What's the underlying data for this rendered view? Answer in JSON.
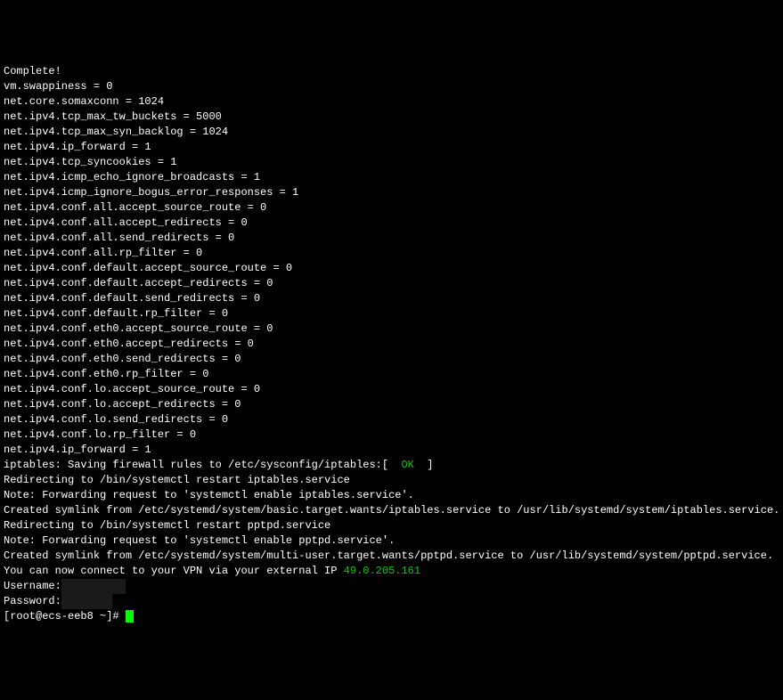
{
  "terminal": {
    "lines": [
      {
        "text": "Complete!"
      },
      {
        "text": "vm.swappiness = 0"
      },
      {
        "text": "net.core.somaxconn = 1024"
      },
      {
        "text": "net.ipv4.tcp_max_tw_buckets = 5000"
      },
      {
        "text": "net.ipv4.tcp_max_syn_backlog = 1024"
      },
      {
        "text": "net.ipv4.ip_forward = 1"
      },
      {
        "text": "net.ipv4.tcp_syncookies = 1"
      },
      {
        "text": "net.ipv4.icmp_echo_ignore_broadcasts = 1"
      },
      {
        "text": "net.ipv4.icmp_ignore_bogus_error_responses = 1"
      },
      {
        "text": "net.ipv4.conf.all.accept_source_route = 0"
      },
      {
        "text": "net.ipv4.conf.all.accept_redirects = 0"
      },
      {
        "text": "net.ipv4.conf.all.send_redirects = 0"
      },
      {
        "text": "net.ipv4.conf.all.rp_filter = 0"
      },
      {
        "text": "net.ipv4.conf.default.accept_source_route = 0"
      },
      {
        "text": "net.ipv4.conf.default.accept_redirects = 0"
      },
      {
        "text": "net.ipv4.conf.default.send_redirects = 0"
      },
      {
        "text": "net.ipv4.conf.default.rp_filter = 0"
      },
      {
        "text": "net.ipv4.conf.eth0.accept_source_route = 0"
      },
      {
        "text": "net.ipv4.conf.eth0.accept_redirects = 0"
      },
      {
        "text": "net.ipv4.conf.eth0.send_redirects = 0"
      },
      {
        "text": "net.ipv4.conf.eth0.rp_filter = 0"
      },
      {
        "text": "net.ipv4.conf.lo.accept_source_route = 0"
      },
      {
        "text": "net.ipv4.conf.lo.accept_redirects = 0"
      },
      {
        "text": "net.ipv4.conf.lo.send_redirects = 0"
      },
      {
        "text": "net.ipv4.conf.lo.rp_filter = 0"
      },
      {
        "text": "net.ipv4.ip_forward = 1"
      }
    ],
    "iptables_prefix": "iptables: Saving firewall rules to /etc/sysconfig/iptables:[  ",
    "iptables_ok": "OK",
    "iptables_suffix": "  ]",
    "post_iptables": [
      {
        "text": "Redirecting to /bin/systemctl restart iptables.service"
      },
      {
        "text": "Note: Forwarding request to 'systemctl enable iptables.service'."
      },
      {
        "text": "Created symlink from /etc/systemd/system/basic.target.wants/iptables.service to /usr/lib/systemd/system/iptables.service."
      },
      {
        "text": "Redirecting to /bin/systemctl restart pptpd.service"
      },
      {
        "text": "Note: Forwarding request to 'systemctl enable pptpd.service'."
      },
      {
        "text": "Created symlink from /etc/systemd/system/multi-user.target.wants/pptpd.service to /usr/lib/systemd/system/pptpd.service."
      }
    ],
    "vpn_prefix": "You can now connect to your VPN via your external IP ",
    "vpn_ip": "49.0.205.161",
    "username_label": "Username:",
    "password_label": "Password:",
    "prompt": "[root@ecs-eeb8 ~]#"
  }
}
